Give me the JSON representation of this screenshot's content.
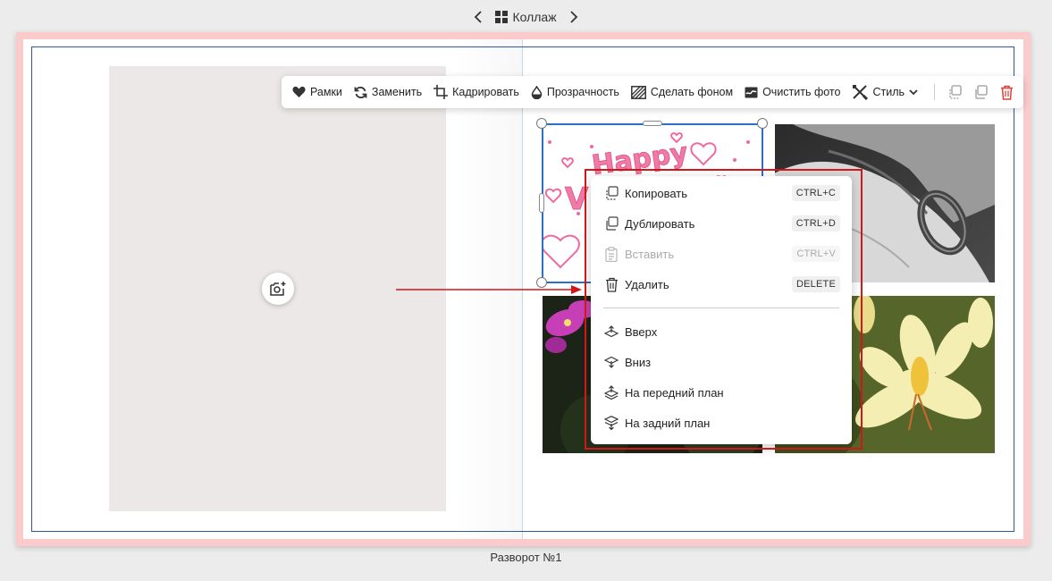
{
  "nav": {
    "layout_title": "Коллаж",
    "layout_icon": "grid-layout-icon"
  },
  "toolbar": {
    "frames": "Рамки",
    "replace": "Заменить",
    "crop": "Кадрировать",
    "transparency": "Прозрачность",
    "make_background": "Сделать фоном",
    "clear_photo": "Очистить фото",
    "style": "Стиль"
  },
  "context_menu": {
    "copy": {
      "label": "Копировать",
      "shortcut": "CTRL+C"
    },
    "duplicate": {
      "label": "Дублировать",
      "shortcut": "CTRL+D"
    },
    "paste": {
      "label": "Вставить",
      "shortcut": "CTRL+V",
      "disabled": true
    },
    "delete": {
      "label": "Удалить",
      "shortcut": "DELETE"
    },
    "up": {
      "label": "Вверх"
    },
    "down": {
      "label": "Вниз"
    },
    "bring_front": {
      "label": "На передний план"
    },
    "send_back": {
      "label": "На задний план"
    }
  },
  "spread": {
    "label": "Разворот №1"
  },
  "colors": {
    "page_border": "#fbcaca",
    "selection": "#2a6fc9",
    "annotation": "#d01818",
    "delete_icon": "#e0403a"
  }
}
